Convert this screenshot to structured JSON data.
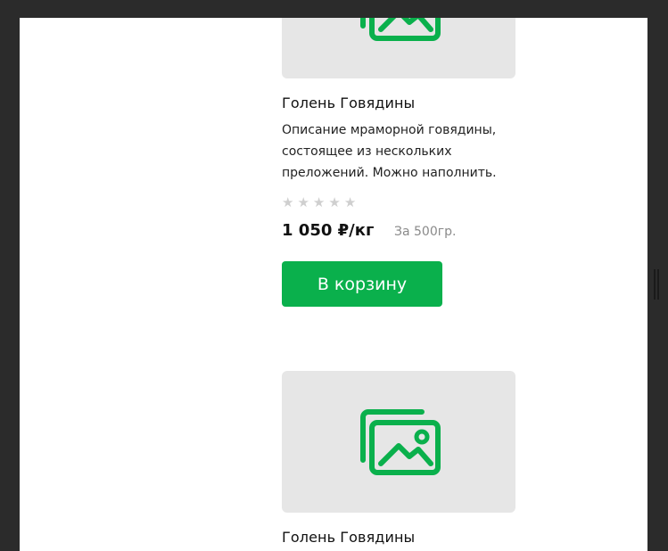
{
  "products": [
    {
      "title": "Голень Говядины",
      "description": "Описание мраморной говядины, состоящее из нескольких преложений. Можно наполнить.",
      "rating": {
        "value": 0,
        "max": 5,
        "star_glyph": "★"
      },
      "price": "1 050 ₽/кг",
      "unit_note": "За 500гр.",
      "button_label": "В корзину",
      "image_icon": "image-gallery-icon"
    },
    {
      "title": "Голень Говядины",
      "image_icon": "image-gallery-icon"
    }
  ],
  "colors": {
    "accent": "#0ab04c",
    "placeholder_bg": "#e6e6e6",
    "star_empty": "#cfcfcf",
    "muted_text": "#8a8a8a",
    "outer_bg": "#2b2b2b"
  }
}
